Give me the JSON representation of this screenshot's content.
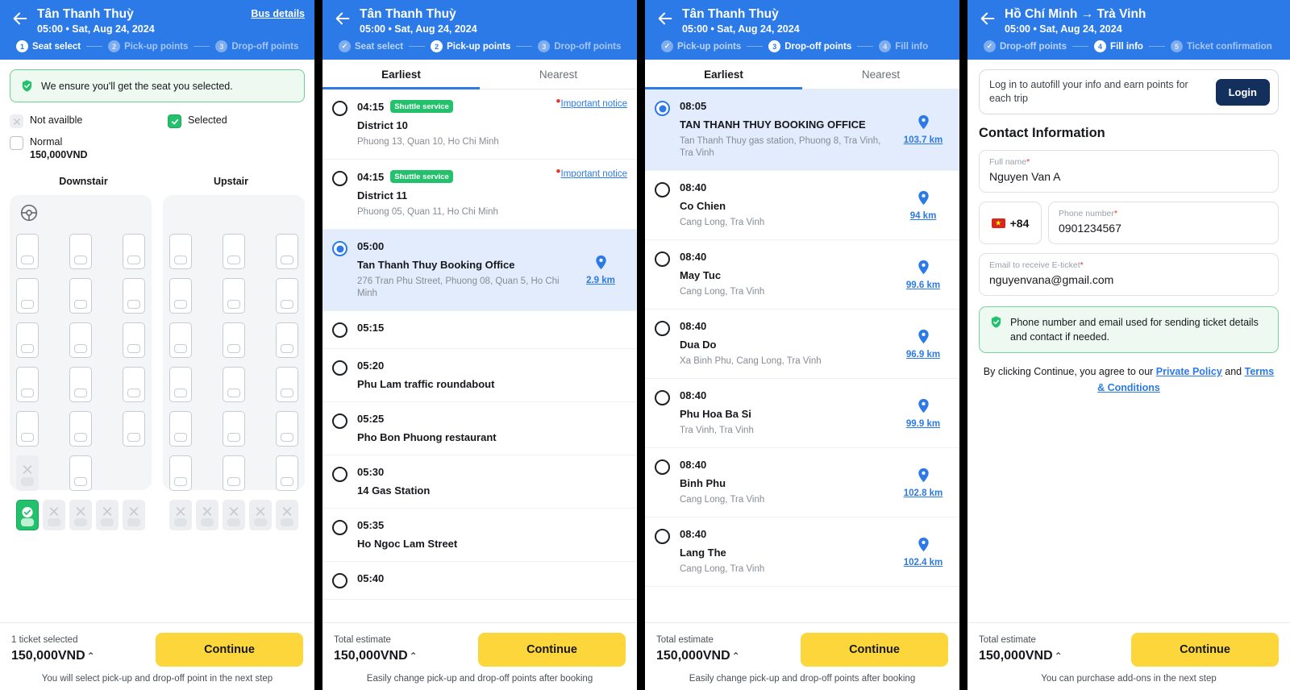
{
  "panels": {
    "seat": {
      "header": {
        "title": "Tân Thanh Thuỳ",
        "subtitle": "05:00 • Sat, Aug 24, 2024",
        "bus_details": "Bus details",
        "back_icon": "back-arrow-icon"
      },
      "steps": [
        {
          "num": "1",
          "label": "Seat select",
          "state": "active"
        },
        {
          "num": "2",
          "label": "Pick-up points",
          "state": "todo"
        },
        {
          "num": "3",
          "label": "Drop-off points",
          "state": "todo"
        }
      ],
      "assurance": "We ensure you'll get the seat you selected.",
      "legend": {
        "not_available": "Not availble",
        "selected": "Selected",
        "normal": "Normal",
        "normal_price": "150,000VND"
      },
      "decks": [
        {
          "title": "Downstair",
          "has_wheel": true,
          "rows": [
            [
              "normal",
              "normal",
              "normal"
            ],
            [
              "normal",
              "normal",
              "normal"
            ],
            [
              "normal",
              "normal",
              "normal"
            ],
            [
              "normal",
              "normal",
              "normal"
            ],
            [
              "normal",
              "normal",
              "normal"
            ],
            [
              "na",
              "normal",
              "none"
            ]
          ],
          "back_row": [
            "selected",
            "na",
            "na",
            "na",
            "na"
          ]
        },
        {
          "title": "Upstair",
          "has_wheel": false,
          "rows": [
            [
              "normal",
              "normal",
              "normal"
            ],
            [
              "normal",
              "normal",
              "normal"
            ],
            [
              "normal",
              "normal",
              "normal"
            ],
            [
              "normal",
              "normal",
              "normal"
            ],
            [
              "normal",
              "normal",
              "normal"
            ],
            [
              "normal",
              "normal",
              "normal"
            ]
          ],
          "back_row": [
            "na",
            "na",
            "na",
            "na",
            "na"
          ]
        }
      ],
      "bottom": {
        "caption": "1 ticket selected",
        "price": "150,000VND",
        "caret": "⌃",
        "continue": "Continue",
        "note": "You will select pick-up and drop-off point in the next step"
      }
    },
    "pickup": {
      "header": {
        "title": "Tân Thanh Thuỳ",
        "subtitle": "05:00 • Sat, Aug 24, 2024",
        "back_icon": "back-arrow-icon"
      },
      "steps": [
        {
          "num": "✓",
          "label": "Seat select",
          "state": "done"
        },
        {
          "num": "2",
          "label": "Pick-up points",
          "state": "active"
        },
        {
          "num": "3",
          "label": "Drop-off points",
          "state": "todo"
        }
      ],
      "tabs": [
        {
          "label": "Earliest",
          "active": true
        },
        {
          "label": "Nearest",
          "active": false
        }
      ],
      "items": [
        {
          "time": "04:15",
          "badge": "Shuttle service",
          "name": "District 10",
          "address": "Phuong 13, Quan 10, Ho Chi Minh",
          "notice": "Important notice",
          "selected": false
        },
        {
          "time": "04:15",
          "badge": "Shuttle service",
          "name": "District 11",
          "address": "Phuong 05, Quan 11, Ho Chi Minh",
          "notice": "Important notice",
          "selected": false
        },
        {
          "time": "05:00",
          "name": "Tan Thanh Thuy Booking Office",
          "address": "276 Tran Phu Street, Phuong 08, Quan 5, Ho Chi Minh",
          "distance": "2.9 km",
          "selected": true
        },
        {
          "time": "05:15",
          "name": "",
          "selected": false
        },
        {
          "time": "05:20",
          "name": "Phu Lam traffic roundabout",
          "selected": false
        },
        {
          "time": "05:25",
          "name": "Pho Bon Phuong restaurant",
          "selected": false
        },
        {
          "time": "05:30",
          "name": "14 Gas Station",
          "selected": false
        },
        {
          "time": "05:35",
          "name": "Ho Ngoc Lam Street",
          "selected": false
        },
        {
          "time": "05:40",
          "name": "",
          "selected": false
        }
      ],
      "bottom": {
        "caption": "Total estimate",
        "price": "150,000VND",
        "caret": "⌃",
        "continue": "Continue",
        "note": "Easily change pick-up and drop-off points after booking"
      }
    },
    "dropoff": {
      "header": {
        "title": "Tân Thanh Thuỳ",
        "subtitle": "05:00 • Sat, Aug 24, 2024",
        "back_icon": "back-arrow-icon"
      },
      "steps": [
        {
          "num": "✓",
          "label": "Pick-up points",
          "state": "done"
        },
        {
          "num": "3",
          "label": "Drop-off points",
          "state": "active"
        },
        {
          "num": "4",
          "label": "Fill info",
          "state": "todo"
        }
      ],
      "tabs": [
        {
          "label": "Earliest",
          "active": true
        },
        {
          "label": "Nearest",
          "active": false
        }
      ],
      "items": [
        {
          "time": "08:05",
          "name": "TAN THANH THUY BOOKING OFFICE",
          "address": "Tan Thanh Thuy gas station, Phuong 8, Tra Vinh, Tra Vinh",
          "distance": "103.7 km",
          "selected": true
        },
        {
          "time": "08:40",
          "name": "Co Chien",
          "address": "Cang Long, Tra Vinh",
          "distance": "94 km",
          "selected": false
        },
        {
          "time": "08:40",
          "name": "May Tuc",
          "address": "Cang Long, Tra Vinh",
          "distance": "99.6 km",
          "selected": false
        },
        {
          "time": "08:40",
          "name": "Dua Do",
          "address": "Xa Binh Phu, Cang Long, Tra Vinh",
          "distance": "96.9 km",
          "selected": false
        },
        {
          "time": "08:40",
          "name": "Phu Hoa Ba Si",
          "address": "Tra Vinh, Tra Vinh",
          "distance": "99.9 km",
          "selected": false
        },
        {
          "time": "08:40",
          "name": "Binh Phu",
          "address": "Cang Long, Tra Vinh",
          "distance": "102.8 km",
          "selected": false
        },
        {
          "time": "08:40",
          "name": "Lang The",
          "address": "Cang Long, Tra Vinh",
          "distance": "102.4 km",
          "selected": false
        }
      ],
      "bottom": {
        "caption": "Total estimate",
        "price": "150,000VND",
        "caret": "⌃",
        "continue": "Continue",
        "note": "Easily change pick-up and drop-off points after booking"
      }
    },
    "fillinfo": {
      "header": {
        "title": "Hồ Chí Minh → Trà Vinh",
        "subtitle": "05:00 • Sat, Aug 24, 2024",
        "back_icon": "back-arrow-icon"
      },
      "steps": [
        {
          "num": "✓",
          "label": "Drop-off points",
          "state": "done"
        },
        {
          "num": "4",
          "label": "Fill info",
          "state": "active"
        },
        {
          "num": "5",
          "label": "Ticket confirmation",
          "state": "todo"
        }
      ],
      "login_card": {
        "text": "Log in to autofill your info and earn points for each trip",
        "button": "Login"
      },
      "section_title": "Contact Information",
      "fields": {
        "full_name": {
          "label": "Full name",
          "value": "Nguyen Van A",
          "required": "*"
        },
        "country_code": {
          "value": "+84",
          "flag": "vietnam-flag-icon"
        },
        "phone": {
          "label": "Phone number",
          "value": "0901234567",
          "required": "*"
        },
        "email": {
          "label": "Email to receive E-ticket",
          "value": "nguyenvana@gmail.com",
          "required": "*"
        }
      },
      "green_note": "Phone number and email used for sending ticket details and contact if needed.",
      "terms": {
        "prefix": "By clicking Continue, you agree to our ",
        "link1": "Private Policy",
        "middle": " and ",
        "link2": "Terms & Conditions"
      },
      "bottom": {
        "caption": "Total estimate",
        "price": "150,000VND",
        "caret": "⌃",
        "continue": "Continue",
        "note": "You can purchase add-ons in the next step"
      }
    }
  },
  "colors": {
    "brand_blue": "#2b7ae8",
    "accent_yellow": "#fdd63c",
    "success_green": "#23c16b",
    "selected_row": "#e2ecfd",
    "navy": "#13305c"
  }
}
